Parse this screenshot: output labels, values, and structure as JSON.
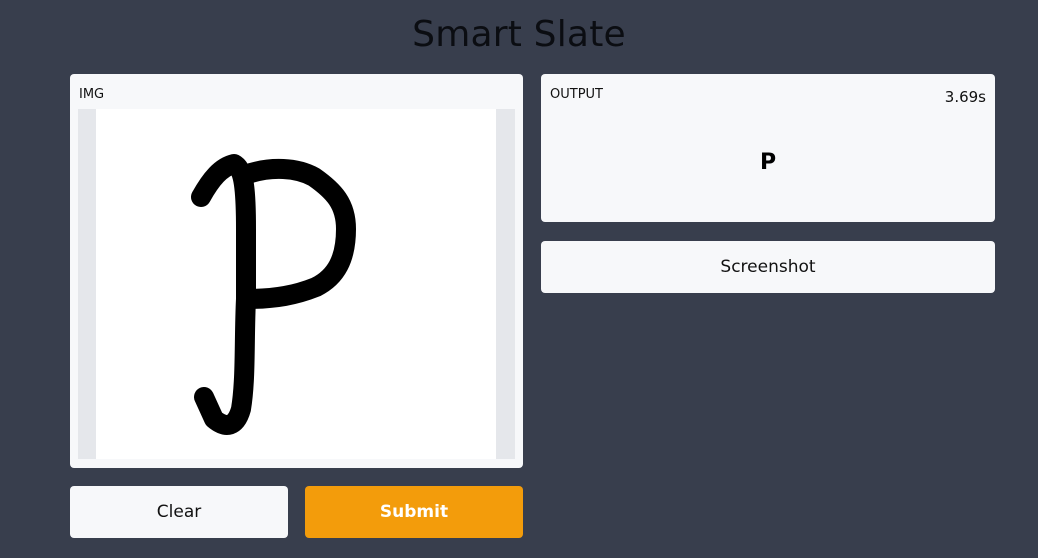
{
  "app": {
    "title": "Smart Slate"
  },
  "input_panel": {
    "label": "IMG"
  },
  "output_panel": {
    "label": "OUTPUT",
    "elapsed": "3.69s",
    "result": "P"
  },
  "buttons": {
    "screenshot": "Screenshot",
    "clear": "Clear",
    "submit": "Submit"
  },
  "colors": {
    "background": "#383e4d",
    "panel": "#f7f8fa",
    "submit": "#f39c0b",
    "stroke": "#000000"
  }
}
